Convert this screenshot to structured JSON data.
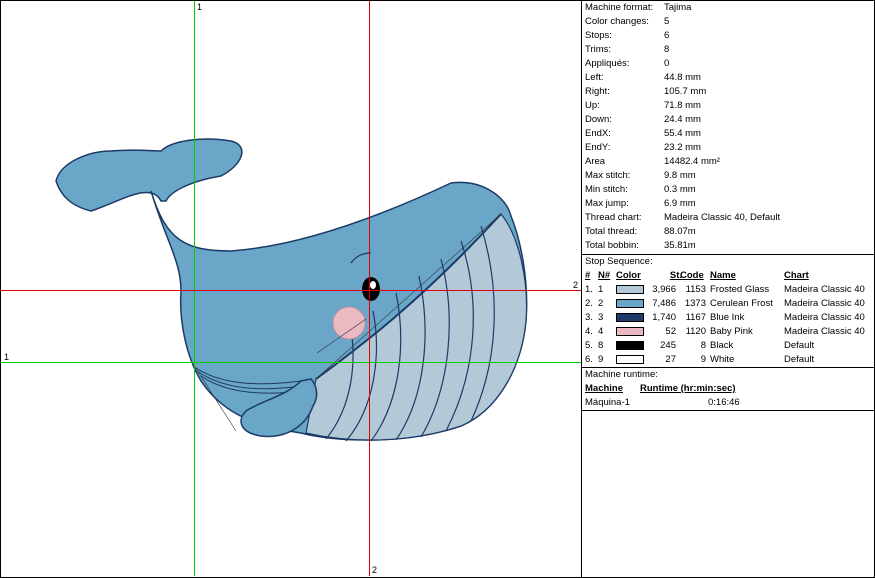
{
  "info": [
    {
      "label": "Machine format:",
      "value": "Tajima"
    },
    {
      "label": "Color changes:",
      "value": "5"
    },
    {
      "label": "Stops:",
      "value": "6"
    },
    {
      "label": "Trims:",
      "value": "8"
    },
    {
      "label": "Appliqués:",
      "value": "0"
    },
    {
      "label": "Left:",
      "value": "44.8 mm"
    },
    {
      "label": "Right:",
      "value": "105.7 mm"
    },
    {
      "label": "Up:",
      "value": "71.8 mm"
    },
    {
      "label": "Down:",
      "value": "24.4 mm"
    },
    {
      "label": "EndX:",
      "value": "55.4 mm"
    },
    {
      "label": "EndY:",
      "value": "23.2 mm"
    },
    {
      "label": "Area",
      "value": "14482.4 mm²"
    },
    {
      "label": "Max stitch:",
      "value": "9.8 mm"
    },
    {
      "label": "Min stitch:",
      "value": "0.3 mm"
    },
    {
      "label": "Max jump:",
      "value": "6.9 mm"
    },
    {
      "label": "Thread chart:",
      "value": "Madeira Classic 40, Default"
    },
    {
      "label": "Total thread:",
      "value": "88.07m"
    },
    {
      "label": "Total bobbin:",
      "value": "35.81m"
    }
  ],
  "stop_sequence": {
    "title": "Stop Sequence:",
    "headers": {
      "num": "#",
      "n": "N#",
      "color": "Color",
      "st": "St.",
      "code": "Code",
      "name": "Name",
      "chart": "Chart"
    },
    "rows": [
      {
        "num": "1.",
        "n": "1",
        "swatch": "#b3c9d8",
        "st": "3,966",
        "code": "1153",
        "name": "Frosted Glass",
        "chart": "Madeira Classic 40"
      },
      {
        "num": "2.",
        "n": "2",
        "swatch": "#6aa6c8",
        "st": "7,486",
        "code": "1373",
        "name": "Cerulean Frost",
        "chart": "Madeira Classic 40"
      },
      {
        "num": "3.",
        "n": "3",
        "swatch": "#1c3a66",
        "st": "1,740",
        "code": "1167",
        "name": "Blue Ink",
        "chart": "Madeira Classic 40"
      },
      {
        "num": "4.",
        "n": "4",
        "swatch": "#eab9c2",
        "st": "52",
        "code": "1120",
        "name": "Baby Pink",
        "chart": "Madeira Classic 40"
      },
      {
        "num": "5.",
        "n": "8",
        "swatch": "#000000",
        "st": "245",
        "code": "8",
        "name": "Black",
        "chart": "Default"
      },
      {
        "num": "6.",
        "n": "9",
        "swatch": "#ffffff",
        "st": "27",
        "code": "9",
        "name": "White",
        "chart": "Default"
      }
    ]
  },
  "runtime": {
    "title": "Machine runtime:",
    "headers": {
      "machine": "Machine",
      "runtime": "Runtime (hr:min:sec)"
    },
    "rows": [
      {
        "machine": "Máquina-1",
        "runtime": "0:16:46"
      }
    ]
  },
  "axes": {
    "green_v": "1",
    "green_h": "1",
    "red_h": "2",
    "red_v": "2"
  },
  "colors": {
    "green_axis": "#00d000",
    "red_axis": "#e00000"
  }
}
